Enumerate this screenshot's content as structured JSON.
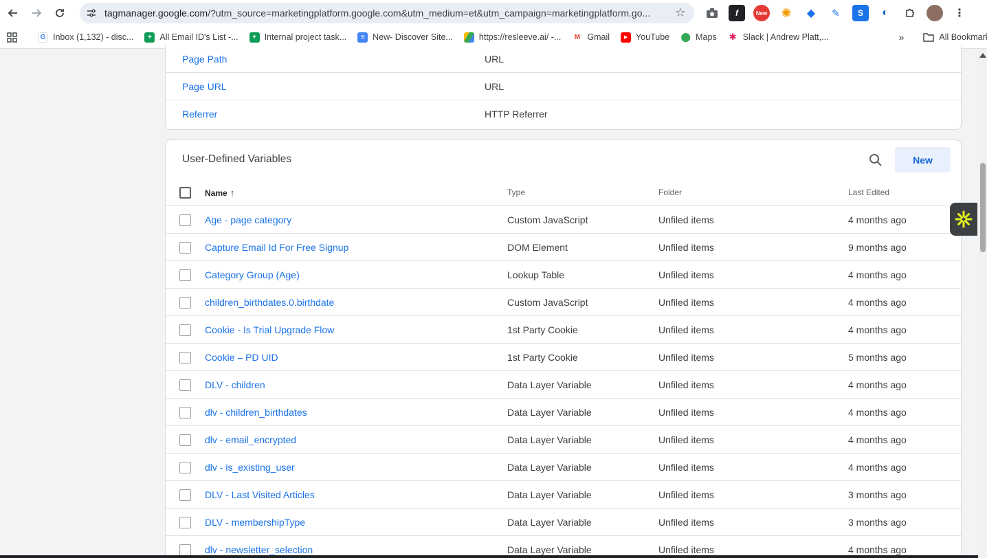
{
  "browser": {
    "url_host": "tagmanager.google.com",
    "url_rest": "/?utm_source=marketingplatform.google.com&utm_medium=et&utm_campaign=marketingplatform.go...",
    "bookmarks": [
      {
        "label": "Inbox (1,132) - disc...",
        "icon": "google-icon",
        "color": "#ffffff"
      },
      {
        "label": "All Email ID's List -...",
        "icon": "sheets-icon",
        "color": "#0f9d58"
      },
      {
        "label": "Internal project task...",
        "icon": "sheets-icon",
        "color": "#0f9d58"
      },
      {
        "label": "New- Discover Site...",
        "icon": "docs-icon",
        "color": "#4285f4"
      },
      {
        "label": "https://resleeve.ai/ -...",
        "icon": "drive-icon",
        "color": "#fbbc04"
      },
      {
        "label": "Gmail",
        "icon": "gmail-icon",
        "color": "#ea4335"
      },
      {
        "label": "YouTube",
        "icon": "youtube-icon",
        "color": "#ff0000"
      },
      {
        "label": "Maps",
        "icon": "maps-icon",
        "color": "#34a853"
      },
      {
        "label": "Slack | Andrew Platt,...",
        "icon": "slack-icon",
        "color": "#4a154b"
      }
    ],
    "all_bookmarks": "All Bookmarks"
  },
  "built_in": {
    "rows": [
      {
        "name": "Page Path",
        "type": "URL"
      },
      {
        "name": "Page URL",
        "type": "URL"
      },
      {
        "name": "Referrer",
        "type": "HTTP Referrer"
      }
    ]
  },
  "user_defined": {
    "title": "User-Defined Variables",
    "new_label": "New",
    "columns": {
      "name": "Name",
      "type": "Type",
      "folder": "Folder",
      "last_edited": "Last Edited"
    },
    "rows": [
      {
        "name": "Age - page category",
        "type": "Custom JavaScript",
        "folder": "Unfiled items",
        "edited": "4 months ago"
      },
      {
        "name": "Capture Email Id For Free Signup",
        "type": "DOM Element",
        "folder": "Unfiled items",
        "edited": "9 months ago"
      },
      {
        "name": "Category Group (Age)",
        "type": "Lookup Table",
        "folder": "Unfiled items",
        "edited": "4 months ago"
      },
      {
        "name": "children_birthdates.0.birthdate",
        "type": "Custom JavaScript",
        "folder": "Unfiled items",
        "edited": "4 months ago"
      },
      {
        "name": "Cookie - Is Trial Upgrade Flow",
        "type": "1st Party Cookie",
        "folder": "Unfiled items",
        "edited": "4 months ago"
      },
      {
        "name": "Cookie – PD UID",
        "type": "1st Party Cookie",
        "folder": "Unfiled items",
        "edited": "5 months ago"
      },
      {
        "name": "DLV - children",
        "type": "Data Layer Variable",
        "folder": "Unfiled items",
        "edited": "4 months ago"
      },
      {
        "name": "dlv - children_birthdates",
        "type": "Data Layer Variable",
        "folder": "Unfiled items",
        "edited": "4 months ago"
      },
      {
        "name": "dlv - email_encrypted",
        "type": "Data Layer Variable",
        "folder": "Unfiled items",
        "edited": "4 months ago"
      },
      {
        "name": "dlv - is_existing_user",
        "type": "Data Layer Variable",
        "folder": "Unfiled items",
        "edited": "4 months ago"
      },
      {
        "name": "DLV - Last Visited Articles",
        "type": "Data Layer Variable",
        "folder": "Unfiled items",
        "edited": "3 months ago"
      },
      {
        "name": "DLV - membershipType",
        "type": "Data Layer Variable",
        "folder": "Unfiled items",
        "edited": "3 months ago"
      },
      {
        "name": "dlv - newsletter_selection",
        "type": "Data Layer Variable",
        "folder": "Unfiled items",
        "edited": "4 months ago"
      }
    ]
  },
  "colors": {
    "link": "#1a73e8",
    "accent_bg": "#e8f0fe"
  }
}
